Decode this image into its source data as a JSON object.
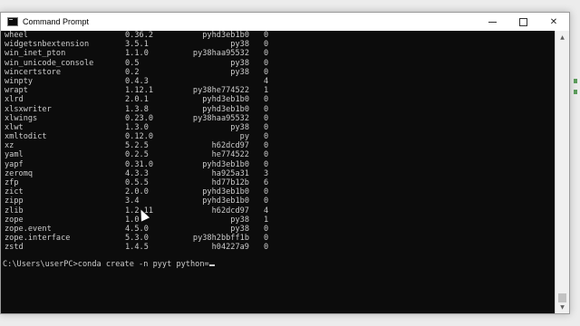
{
  "window": {
    "title": "Command Prompt",
    "controls": {
      "minimize": "—",
      "maximize": "☐",
      "close": "✕"
    }
  },
  "packages": [
    {
      "name": "wheel",
      "version": "0.36.2",
      "build": "pyhd3eb1b0",
      "channel": "0"
    },
    {
      "name": "widgetsnbextension",
      "version": "3.5.1",
      "build": "py38",
      "channel": "0"
    },
    {
      "name": "win_inet_pton",
      "version": "1.1.0",
      "build": "py38haa95532",
      "channel": "0"
    },
    {
      "name": "win_unicode_console",
      "version": "0.5",
      "build": "py38",
      "channel": "0"
    },
    {
      "name": "wincertstore",
      "version": "0.2",
      "build": "py38",
      "channel": "0"
    },
    {
      "name": "winpty",
      "version": "0.4.3",
      "build": "",
      "channel": "4"
    },
    {
      "name": "wrapt",
      "version": "1.12.1",
      "build": "py38he774522",
      "channel": "1"
    },
    {
      "name": "xlrd",
      "version": "2.0.1",
      "build": "pyhd3eb1b0",
      "channel": "0"
    },
    {
      "name": "xlsxwriter",
      "version": "1.3.8",
      "build": "pyhd3eb1b0",
      "channel": "0"
    },
    {
      "name": "xlwings",
      "version": "0.23.0",
      "build": "py38haa95532",
      "channel": "0"
    },
    {
      "name": "xlwt",
      "version": "1.3.0",
      "build": "py38",
      "channel": "0"
    },
    {
      "name": "xmltodict",
      "version": "0.12.0",
      "build": "py",
      "channel": "0"
    },
    {
      "name": "xz",
      "version": "5.2.5",
      "build": "h62dcd97",
      "channel": "0"
    },
    {
      "name": "yaml",
      "version": "0.2.5",
      "build": "he774522",
      "channel": "0"
    },
    {
      "name": "yapf",
      "version": "0.31.0",
      "build": "pyhd3eb1b0",
      "channel": "0"
    },
    {
      "name": "zeromq",
      "version": "4.3.3",
      "build": "ha925a31",
      "channel": "3"
    },
    {
      "name": "zfp",
      "version": "0.5.5",
      "build": "hd77b12b",
      "channel": "6"
    },
    {
      "name": "zict",
      "version": "2.0.0",
      "build": "pyhd3eb1b0",
      "channel": "0"
    },
    {
      "name": "zipp",
      "version": "3.4",
      "build": "pyhd3eb1b0",
      "channel": "0"
    },
    {
      "name": "zlib",
      "version": "1.2.11",
      "build": "h62dcd97",
      "channel": "4"
    },
    {
      "name": "zope",
      "version": "1.0",
      "build": "py38",
      "channel": "1"
    },
    {
      "name": "zope.event",
      "version": "4.5.0",
      "build": "py38",
      "channel": "0"
    },
    {
      "name": "zope.interface",
      "version": "5.3.0",
      "build": "py38h2bbff1b",
      "channel": "0"
    },
    {
      "name": "zstd",
      "version": "1.4.5",
      "build": "h04227a9",
      "channel": "0"
    }
  ],
  "prompt": {
    "path": "C:\\Users\\userPC>",
    "command": "conda create -n pyyt python="
  },
  "colors": {
    "console_bg": "#0c0c0c",
    "console_fg": "#cccccc",
    "titlebar_bg": "#ffffff"
  }
}
